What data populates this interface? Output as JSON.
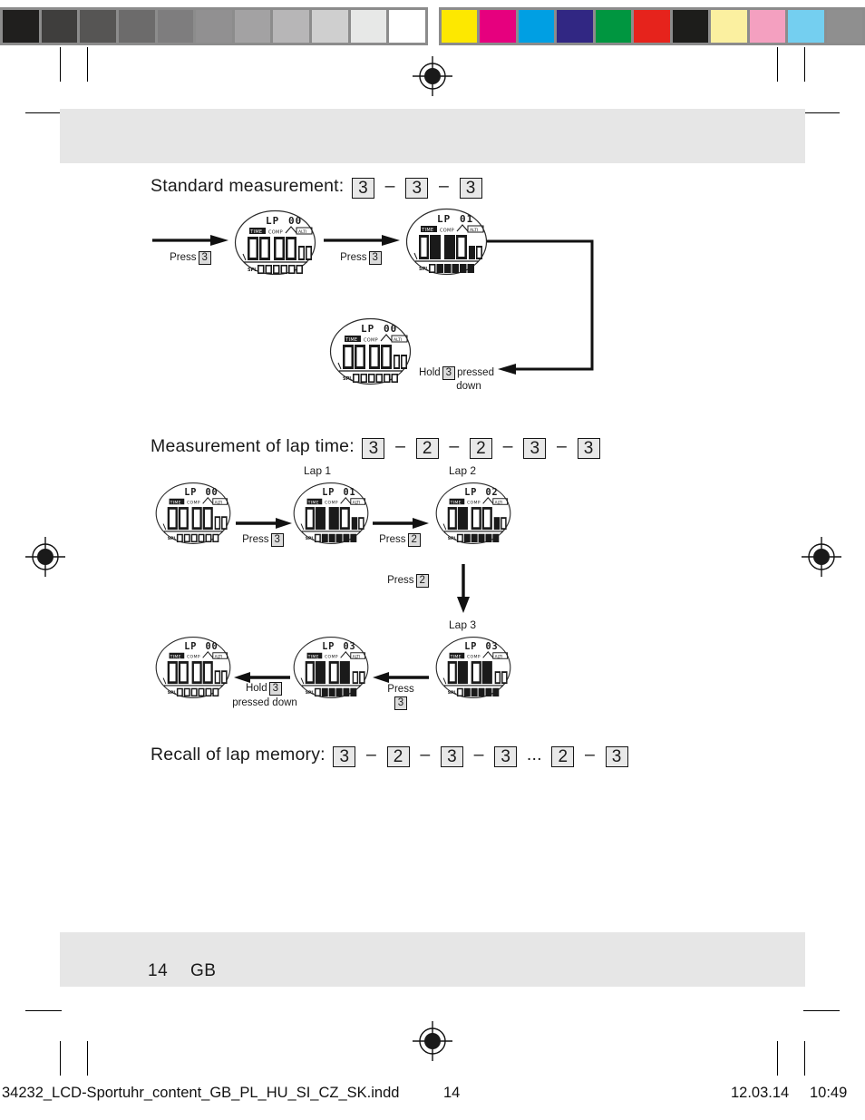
{
  "calibration": {
    "grays": [
      "#201f1e",
      "#3f3e3d",
      "#565554",
      "#6c6b6b",
      "#7e7d7e",
      "#919091",
      "#a3a2a3",
      "#b7b6b7",
      "#cfcfcf",
      "#e7e8e7",
      "#ffffff"
    ],
    "colors": [
      "#fde800",
      "#e6007e",
      "#009fe3",
      "#312783",
      "#009640",
      "#e6231c",
      "#1d1d1b",
      "#fbf0a0",
      "#f4a0c0",
      "#74cff0",
      "#8f8f8f"
    ],
    "frame_color": "#8c8c8c"
  },
  "sections": [
    {
      "id": "standard-measurement",
      "title": "Standard measurement:",
      "keys": [
        "3",
        "3",
        "3"
      ]
    },
    {
      "id": "lap-time-measurement",
      "title": "Measurement of lap time:",
      "keys": [
        "3",
        "2",
        "2",
        "3",
        "3"
      ]
    },
    {
      "id": "recall-lap-memory",
      "title": "Recall of lap memory:",
      "keys": [
        "3",
        "2",
        "3",
        "3",
        "...",
        "2",
        "3"
      ]
    }
  ],
  "labels": {
    "press": "Press",
    "hold": "Hold",
    "pressed_down": "pressed down",
    "pressed": "pressed",
    "down": "down",
    "lap1": "Lap 1",
    "lap2": "Lap 2",
    "lap3": "Lap 3",
    "key3": "3",
    "key2": "2"
  },
  "displays": {
    "d1": {
      "lp_label": "LP",
      "lp_value": "00",
      "seg_time": "TIME",
      "seg_comp": "COMP",
      "seg_alti": "ALTI",
      "main_a": "00",
      "main_b": "00",
      "small": "00",
      "spl_label": "SPL",
      "spl_value": "000000"
    },
    "d2": {
      "lp_label": "LP",
      "lp_value": "01",
      "seg_time": "TIME",
      "seg_comp": "COMP",
      "seg_alti": "ALTI",
      "main_a": "01",
      "main_b": "35",
      "small": "68",
      "spl_label": "SPL",
      "spl_value": "013568"
    },
    "d3": {
      "lp_label": "LP",
      "lp_value": "00",
      "seg_time": "TIME",
      "seg_comp": "COMP",
      "seg_alti": "ALTI",
      "main_a": "00",
      "main_b": "00",
      "small": "00",
      "spl_label": "SPL",
      "spl_value": "000000"
    },
    "d4": {
      "lp_label": "LP",
      "lp_value": "00",
      "seg_time": "TIME",
      "seg_comp": "COMP",
      "seg_alti": "ALTI",
      "main_a": "00",
      "main_b": "00",
      "small": "00",
      "spl_label": "SPL",
      "spl_value": "000000"
    },
    "d5": {
      "lp_label": "LP",
      "lp_value": "01",
      "seg_time": "TIME",
      "seg_comp": "COMP",
      "seg_alti": "ALTI",
      "main_a": "01",
      "main_b": "35",
      "small": "68",
      "spl_label": "SPL",
      "spl_value": "013568"
    },
    "d6": {
      "lp_label": "LP",
      "lp_value": "02",
      "seg_time": "TIME",
      "seg_comp": "COMP",
      "seg_alti": "ALTI",
      "main_a": "01",
      "main_b": "00",
      "small": "30",
      "spl_label": "SPL",
      "spl_value": "023598"
    },
    "d7": {
      "lp_label": "LP",
      "lp_value": "03",
      "seg_time": "TIME",
      "seg_comp": "COMP",
      "seg_alti": "ALTI",
      "main_a": "01",
      "main_b": "03",
      "small": "00",
      "spl_label": "SPL",
      "spl_value": "033598"
    },
    "d8": {
      "lp_label": "LP",
      "lp_value": "03",
      "seg_time": "TIME",
      "seg_comp": "COMP",
      "seg_alti": "ALTI",
      "main_a": "01",
      "main_b": "03",
      "small": "00",
      "spl_label": "SPL",
      "spl_value": "033598"
    },
    "d9": {
      "lp_label": "LP",
      "lp_value": "00",
      "seg_time": "TIME",
      "seg_comp": "COMP",
      "seg_alti": "ALTI",
      "main_a": "00",
      "main_b": "00",
      "small": "00",
      "spl_label": "SPL",
      "spl_value": "000000"
    }
  },
  "page": {
    "number": "14",
    "language": "GB"
  },
  "footer": {
    "filename": "34232_LCD-Sportuhr_content_GB_PL_HU_SI_CZ_SK.indd",
    "page": "14",
    "date": "12.03.14",
    "time": "10:49"
  }
}
